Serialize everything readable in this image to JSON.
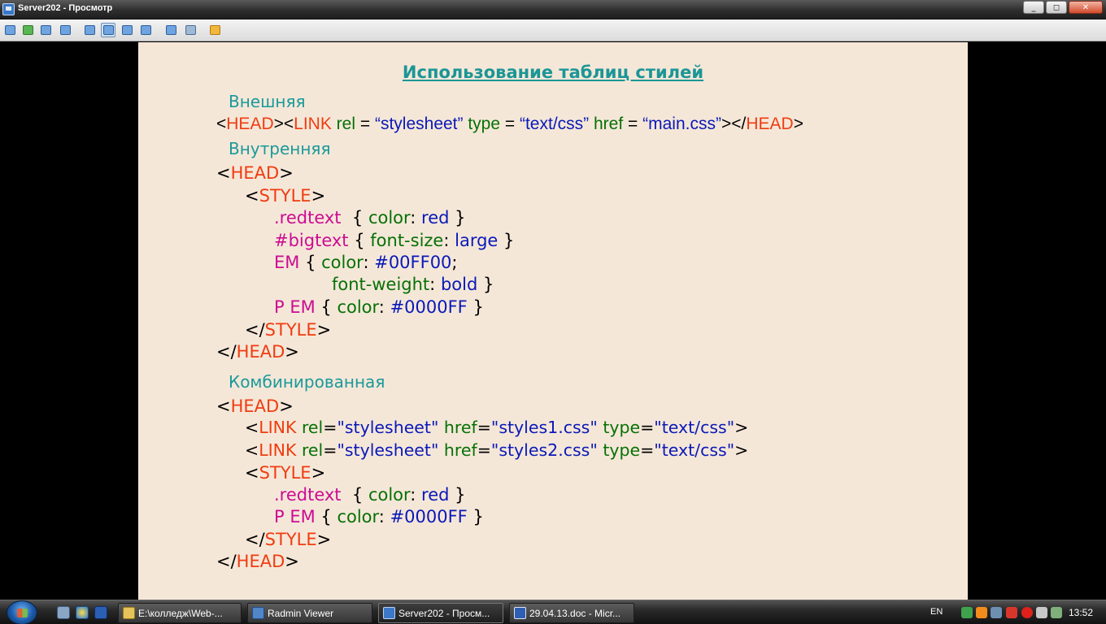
{
  "window": {
    "title": "Server202 - Просмотр",
    "controls": {
      "minimize": "_",
      "restore": "◻",
      "close": "✕"
    }
  },
  "toolbar": {
    "buttons": [
      "full-control-icon",
      "view-only-icon",
      "voice-chat-icon",
      "text-chat-icon",
      "normal-mode-icon",
      "fullscreen-icon",
      "scaled-mode-icon",
      "fit-window-icon",
      "screen-select-icon",
      "settings-icon",
      "close-connection-icon"
    ]
  },
  "slide": {
    "title": "Использование таблиц стилей",
    "external_header": "Внешняя",
    "external_code": [
      "<",
      "HEAD",
      "><",
      "LINK",
      " rel",
      " = ",
      "“stylesheet”",
      " type",
      " = ",
      "“text/css”",
      " href",
      " = ",
      "“main.css”",
      "></",
      "HEAD",
      ">"
    ],
    "internal_header": "Внутренняя",
    "internal_code": {
      "head_open": [
        "<",
        "HEAD",
        ">"
      ],
      "style_open": [
        "<",
        "STYLE",
        ">"
      ],
      "rule1": [
        ".redtext",
        "  { ",
        "color",
        ": ",
        "red",
        " }"
      ],
      "rule2": [
        "#bigtext",
        " { ",
        "font-size",
        ": ",
        "large",
        " }"
      ],
      "rule3a": [
        "EM",
        " { ",
        "color",
        ": ",
        "#00FF00",
        ";"
      ],
      "rule3b": [
        "font-weight",
        ": ",
        "bold",
        " }"
      ],
      "rule4": [
        "P EM",
        " { ",
        "color",
        ": ",
        "#0000FF",
        " }"
      ],
      "style_close": [
        "</",
        "STYLE",
        ">"
      ],
      "head_close": [
        "</",
        "HEAD",
        ">"
      ]
    },
    "combined_header": "Комбинированная",
    "combined_code": {
      "head_open": [
        "<",
        "HEAD",
        ">"
      ],
      "link1": [
        "<",
        "LINK",
        " rel",
        "=",
        "\"stylesheet\"",
        " href",
        "=",
        "\"styles1.css\"",
        " type",
        "=",
        "\"text/css\"",
        ">"
      ],
      "link2": [
        "<",
        "LINK",
        " rel",
        "=",
        "\"stylesheet\"",
        " href",
        "=",
        "\"styles2.css\"",
        " type",
        "=",
        "\"text/css\"",
        ">"
      ],
      "style_open": [
        "<",
        "STYLE",
        ">"
      ],
      "rule1": [
        ".redtext",
        "  { ",
        "color",
        ": ",
        "red",
        " }"
      ],
      "rule2": [
        "P EM",
        " { ",
        "color",
        ": ",
        "#0000FF",
        " }"
      ],
      "style_close": [
        "</",
        "STYLE",
        ">"
      ],
      "head_close": [
        "</",
        "HEAD",
        ">"
      ]
    },
    "colors": {
      "background": "#f5e7d8",
      "header": "#199a9a",
      "tag": "#f03c10",
      "attribute": "#067106",
      "value": "#0a19b8",
      "selector": "#cc0c92"
    }
  },
  "taskbar": {
    "quick_launch": [
      "show-desktop-icon",
      "ie-icon",
      "media-icon"
    ],
    "tasks": [
      {
        "label": "E:\\колледж\\Web-...",
        "icon": "folder-icon",
        "active": false
      },
      {
        "label": "Radmin Viewer",
        "icon": "radmin-icon",
        "active": false
      },
      {
        "label": "Server202 - Просм...",
        "icon": "radmin-view-icon",
        "active": true
      },
      {
        "label": "29.04.13.doc - Micr...",
        "icon": "word-icon",
        "active": false
      }
    ],
    "language": "EN",
    "tray_icons": [
      "network-icon",
      "media-player-icon",
      "monitor-icon",
      "shield-icon",
      "opera-icon",
      "volume-icon",
      "safe-remove-icon"
    ],
    "clock": "13:52"
  }
}
